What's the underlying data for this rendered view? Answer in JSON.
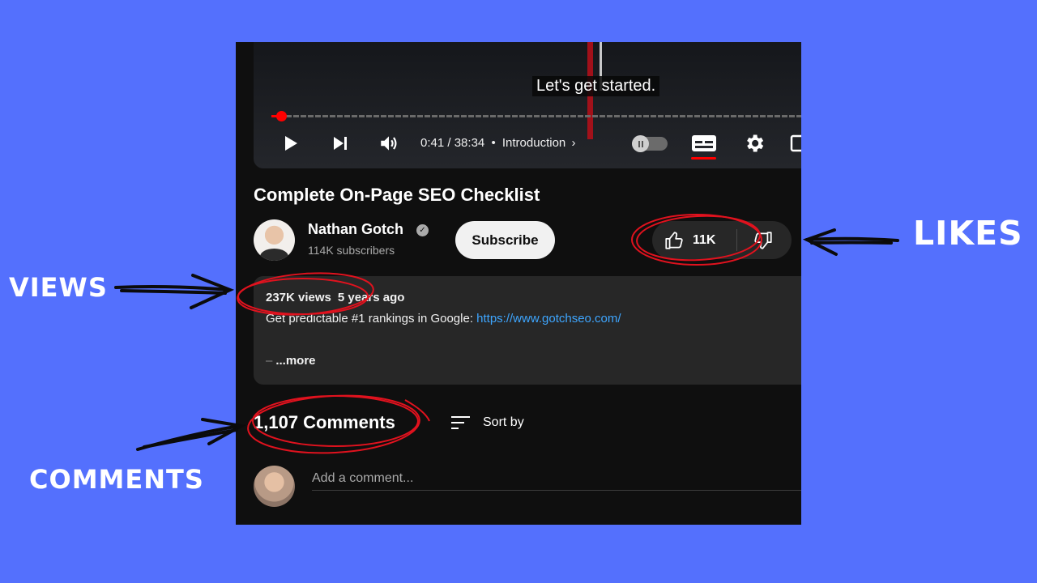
{
  "player": {
    "caption": "Let's get started.",
    "time_current": "0:41",
    "time_total": "38:34",
    "chapter": "Introduction",
    "progress_fraction": 0.018
  },
  "video": {
    "title": "Complete On-Page SEO Checklist"
  },
  "channel": {
    "name": "Nathan Gotch",
    "verified_mark": "✓",
    "subscribers": "114K subscribers",
    "subscribe_label": "Subscribe"
  },
  "actions": {
    "likes": "11K"
  },
  "description": {
    "views": "237K views",
    "date": "5 years ago",
    "text": "Get predictable #1 rankings in Google: ",
    "link": "https://www.gotchseo.com/",
    "dash": "–",
    "more": "...more"
  },
  "comments": {
    "count_label": "1,107 Comments",
    "sort_label": "Sort by",
    "input_placeholder": "Add a comment..."
  },
  "annotations": {
    "views": "VIEWS",
    "likes": "LIKES",
    "comments": "COMMENTS"
  },
  "colors": {
    "background": "#5470fd",
    "panel": "#0f0f0f",
    "accent_red": "#ff0000",
    "link": "#3ea6ff"
  }
}
